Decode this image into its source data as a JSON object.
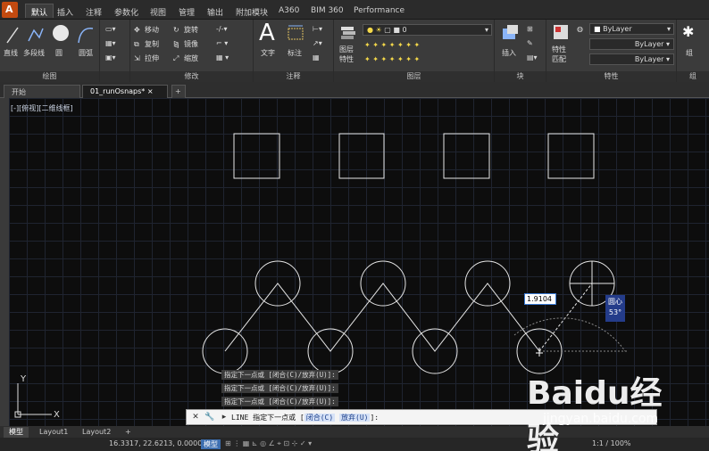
{
  "ribbon_tabs": [
    "默认",
    "插入",
    "注释",
    "参数化",
    "视图",
    "管理",
    "输出",
    "附加模块",
    "A360",
    "BIM 360",
    "Performance"
  ],
  "active_ribbon_tab": "默认",
  "panels": {
    "draw": {
      "label": "绘图",
      "line": "直线",
      "polyline": "多段线",
      "circle": "圆",
      "arc": "圆弧"
    },
    "modify": {
      "label": "修改",
      "move": "移动",
      "rotate": "旋转",
      "copy": "复制",
      "mirror": "镜像",
      "stretch": "拉伸",
      "scale": "缩放"
    },
    "annotation": {
      "label": "注释",
      "text": "文字",
      "dimension": "标注"
    },
    "layers": {
      "label": "图层",
      "properties": "图层\n特性",
      "current_layer": "0"
    },
    "block": {
      "label": "块",
      "insert": "插入"
    },
    "properties": {
      "label": "特性",
      "match": "特性\n匹配",
      "color": "ByLayer",
      "linetype": "ByLayer",
      "lineweight": "ByLayer"
    },
    "groups": {
      "label": "组",
      "group": "组"
    }
  },
  "doc_tabs": [
    "开始",
    "01_runOsnaps*"
  ],
  "active_doc_tab": "01_runOsnaps*",
  "viewport_label": "[-][俯视][二维线框]",
  "command_history": [
    "指定下一点或 [闭合(C)/放弃(U)]:",
    "指定下一点或 [闭合(C)/放弃(U)]:",
    "指定下一点或 [闭合(C)/放弃(U)]:"
  ],
  "command_line": {
    "prefix": "LINE 指定下一点或 [",
    "opt1": "闭合(C)",
    "mid": " ",
    "opt2": "放弃(U)",
    "suffix": "]:"
  },
  "dynamic_input": "1.9104",
  "snap_tooltip": {
    "mode": "圆心",
    "angle": "53°"
  },
  "ucs": {
    "x": "X",
    "y": "Y"
  },
  "layout_tabs": [
    "模型",
    "Layout1",
    "Layout2"
  ],
  "active_layout": "模型",
  "status": {
    "coords": "16.3317, 22.6213, 0.0000",
    "space": "模型",
    "scale": "1:1 / 100%"
  },
  "watermark": {
    "logo": "Baidu经验",
    "url": "jingyan.baidu.com"
  }
}
